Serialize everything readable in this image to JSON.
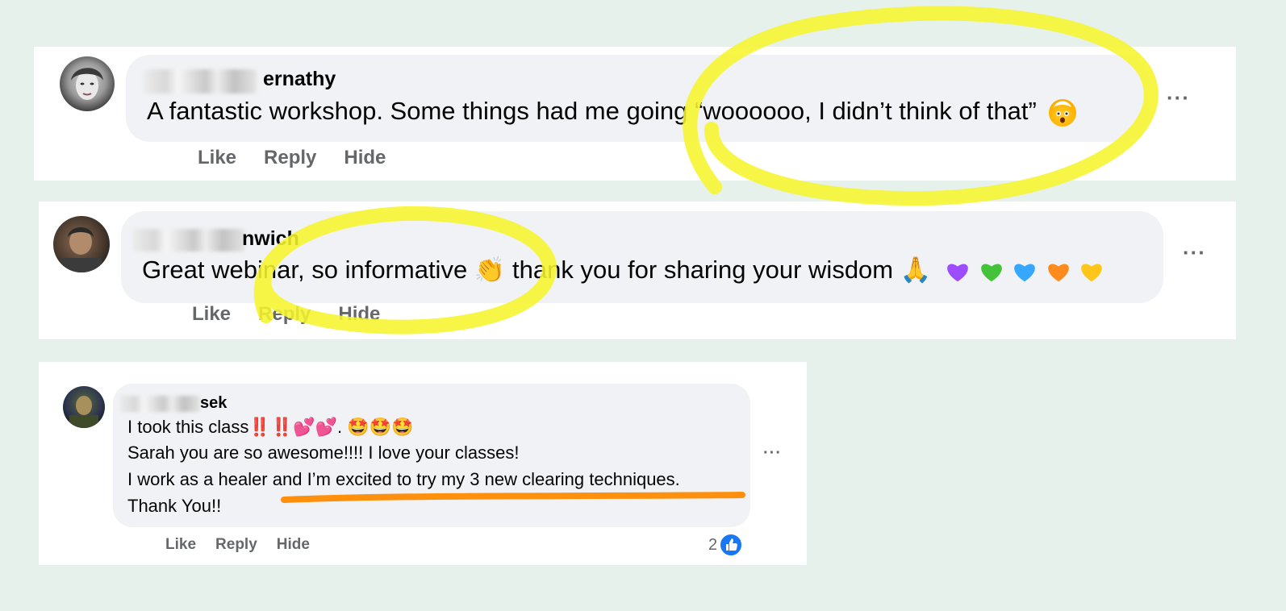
{
  "comments": [
    {
      "author_visible": "ernathy",
      "text": "A fantastic workshop. Some things had me going “woooooo, I didn’t think of that”",
      "emoji": "exploding-head",
      "actions": [
        "Like",
        "Reply",
        "Hide"
      ]
    },
    {
      "author_visible": "nwich",
      "text": "Great webinar, so informative 👏 thank you for sharing your wisdom 🙏",
      "emoji_hearts": [
        "purple",
        "green",
        "blue",
        "orange",
        "yellow"
      ],
      "actions": [
        "Like",
        "Reply",
        "Hide"
      ]
    },
    {
      "author_visible": "sek",
      "lines": [
        "I took this class‼️‼️💕💕. 🤩🤩🤩",
        "Sarah you are so awesome!!!! I love your classes!",
        "I work as a healer and I’m excited to try my 3 new clearing techniques.",
        "Thank You!!"
      ],
      "actions": [
        "Like",
        "Reply",
        "Hide"
      ],
      "reaction_count": "2"
    }
  ],
  "more_label": "···",
  "colors": {
    "background": "#e5f1ea",
    "bubble": "#f0f2f5",
    "highlight_yellow": "#f6f52c",
    "underline_orange": "#ff8a00",
    "like_blue": "#1877f2"
  }
}
